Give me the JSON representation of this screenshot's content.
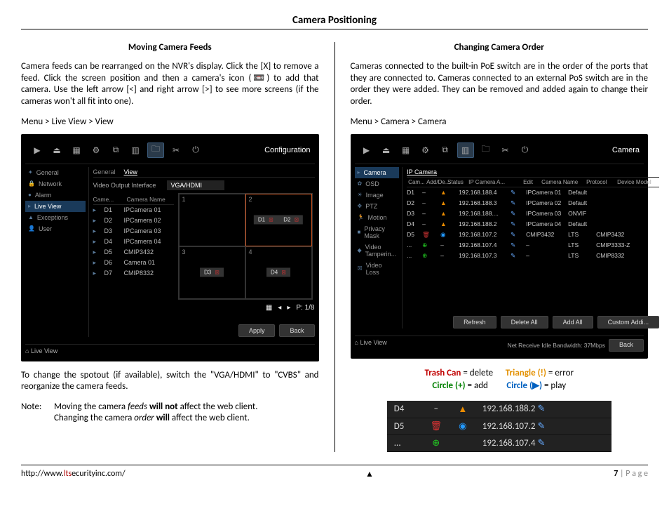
{
  "page": {
    "title": "Camera Positioning",
    "url_pre": "http://www.",
    "url_red": "lts",
    "url_post": "ecurityinc.com/",
    "footer_page": "7 | P a g e"
  },
  "left": {
    "heading": "Moving Camera Feeds",
    "p1": "Camera feeds can be rearranged on the NVR's display.  Click the [X] to remove a feed.  Click the screen position and then a camera's icon (📼) to add that camera.  Use the left arrow [<] and right arrow [>] to see more screens (if the cameras won't all fit into one).",
    "path": "Menu > Live View > View",
    "below": "To change the spotout (if available), switch the \"VGA/HDMI\" to \"CVBS\" and reorganize the camera feeds.",
    "note_label": "Note:",
    "note1a": "Moving the camera ",
    "note1b": "feeds",
    "note1c": " will not",
    "note1d": " affect the web client.",
    "note2a": "Changing the camera ",
    "note2b": "order",
    "note2c": " will",
    "note2d": " affect the web client."
  },
  "right": {
    "heading": "Changing Camera Order",
    "p1": "Cameras connected to the built-in PoE switch are in the order of the ports that they are connected to.  Cameras connected to an external PoS switch are in the order they were added.  They can be removed and added again to change their order.",
    "path": "Menu > Camera > Camera"
  },
  "nvr1": {
    "title": "Configuration",
    "sidebar": [
      "General",
      "Network",
      "Alarm",
      "Live View",
      "Exceptions",
      "User"
    ],
    "active_sidebar": 3,
    "tabs": [
      "General",
      "View"
    ],
    "active_tab": 1,
    "out_label": "Video Output Interface",
    "out_value": "VGA/HDMI",
    "list_hdr": [
      "Came...",
      "Camera Name"
    ],
    "cams": [
      {
        "id": "D1",
        "name": "IPCamera 01"
      },
      {
        "id": "D2",
        "name": "IPCamera 02"
      },
      {
        "id": "D3",
        "name": "IPCamera 03"
      },
      {
        "id": "D4",
        "name": "IPCamera 04"
      },
      {
        "id": "D5",
        "name": "CMIP3432"
      },
      {
        "id": "D6",
        "name": "Camera 01"
      },
      {
        "id": "D7",
        "name": "CMIP8332"
      }
    ],
    "cells": [
      "D1",
      "D2",
      "D3",
      "D4"
    ],
    "pager": "P: 1/8",
    "btn_apply": "Apply",
    "btn_back": "Back",
    "live": "Live View"
  },
  "nvr2": {
    "title": "Camera",
    "sidebar": [
      "Camera",
      "OSD",
      "Image",
      "PTZ",
      "Motion",
      "Privacy Mask",
      "Video Tamperin...",
      "Video Loss"
    ],
    "active_sidebar": 0,
    "section": "IP Camera",
    "cols": [
      "Cam...",
      "Add/De...",
      "Status",
      "IP Camera A...",
      "Edit",
      "Camera Name",
      "Protocol",
      "Device Model"
    ],
    "rows": [
      {
        "cam": "D1",
        "del": "–",
        "stat": "warn",
        "ip": "192.168.188.4",
        "edit": "✎",
        "name": "IPCamera 01",
        "prot": "Default",
        "model": ""
      },
      {
        "cam": "D2",
        "del": "–",
        "stat": "warn",
        "ip": "192.168.188.3",
        "edit": "✎",
        "name": "IPCamera 02",
        "prot": "Default",
        "model": ""
      },
      {
        "cam": "D3",
        "del": "–",
        "stat": "warn",
        "ip": "192.168.188....",
        "edit": "✎",
        "name": "IPCamera 03",
        "prot": "ONVIF",
        "model": ""
      },
      {
        "cam": "D4",
        "del": "–",
        "stat": "warn",
        "ip": "192.168.188.2",
        "edit": "✎",
        "name": "IPCamera 04",
        "prot": "Default",
        "model": ""
      },
      {
        "cam": "D5",
        "del": "trash",
        "stat": "play",
        "ip": "192.168.107.2",
        "edit": "✎",
        "name": "CMIP3432",
        "prot": "LTS",
        "model": "CMIP3432"
      },
      {
        "cam": "...",
        "del": "add",
        "stat": "–",
        "ip": "192.168.107.4",
        "edit": "✎",
        "name": "–",
        "prot": "LTS",
        "model": "CMIP3333-Z"
      },
      {
        "cam": "...",
        "del": "add",
        "stat": "–",
        "ip": "192.168.107.3",
        "edit": "✎",
        "name": "–",
        "prot": "LTS",
        "model": "CMIP8332"
      }
    ],
    "btn_refresh": "Refresh",
    "btn_delall": "Delete All",
    "btn_addall": "Add All",
    "btn_custom": "Custom Addi...",
    "bandwidth": "Net Receive Idle Bandwidth: 37Mbps",
    "btn_back": "Back",
    "live": "Live View"
  },
  "legend": {
    "trash_lbl": "Trash Can",
    "trash_eq": " = delete",
    "tri_lbl": "Triangle (!)",
    "tri_eq": " = error",
    "plus_lbl": "Circle (+)",
    "plus_eq": " = add",
    "play_lbl": "Circle (▶)",
    "play_eq": " = play"
  },
  "closeup": {
    "rows": [
      {
        "cam": "D4",
        "del": "–",
        "stat": "warn",
        "ip": "192.168.188.2"
      },
      {
        "cam": "D5",
        "del": "trash",
        "stat": "play",
        "ip": "192.168.107.2"
      },
      {
        "cam": "...",
        "del": "add",
        "stat": "",
        "ip": "192.168.107.4"
      }
    ]
  }
}
